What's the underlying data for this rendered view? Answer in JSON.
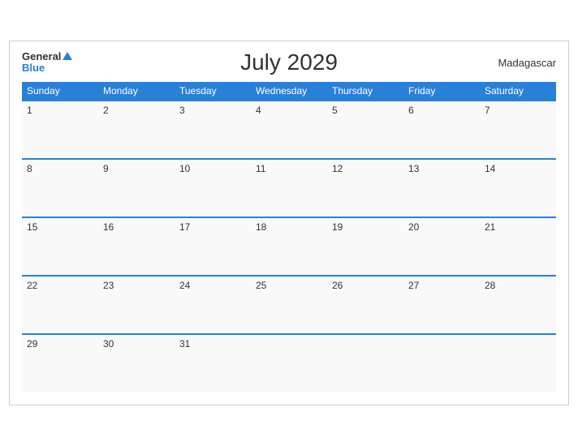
{
  "header": {
    "title": "July 2029",
    "country": "Madagascar",
    "logo_general": "General",
    "logo_blue": "Blue"
  },
  "weekdays": [
    "Sunday",
    "Monday",
    "Tuesday",
    "Wednesday",
    "Thursday",
    "Friday",
    "Saturday"
  ],
  "weeks": [
    [
      {
        "day": 1,
        "empty": false
      },
      {
        "day": 2,
        "empty": false
      },
      {
        "day": 3,
        "empty": false
      },
      {
        "day": 4,
        "empty": false
      },
      {
        "day": 5,
        "empty": false
      },
      {
        "day": 6,
        "empty": false
      },
      {
        "day": 7,
        "empty": false
      }
    ],
    [
      {
        "day": 8,
        "empty": false
      },
      {
        "day": 9,
        "empty": false
      },
      {
        "day": 10,
        "empty": false
      },
      {
        "day": 11,
        "empty": false
      },
      {
        "day": 12,
        "empty": false
      },
      {
        "day": 13,
        "empty": false
      },
      {
        "day": 14,
        "empty": false
      }
    ],
    [
      {
        "day": 15,
        "empty": false
      },
      {
        "day": 16,
        "empty": false
      },
      {
        "day": 17,
        "empty": false
      },
      {
        "day": 18,
        "empty": false
      },
      {
        "day": 19,
        "empty": false
      },
      {
        "day": 20,
        "empty": false
      },
      {
        "day": 21,
        "empty": false
      }
    ],
    [
      {
        "day": 22,
        "empty": false
      },
      {
        "day": 23,
        "empty": false
      },
      {
        "day": 24,
        "empty": false
      },
      {
        "day": 25,
        "empty": false
      },
      {
        "day": 26,
        "empty": false
      },
      {
        "day": 27,
        "empty": false
      },
      {
        "day": 28,
        "empty": false
      }
    ],
    [
      {
        "day": 29,
        "empty": false
      },
      {
        "day": 30,
        "empty": false
      },
      {
        "day": 31,
        "empty": false
      },
      {
        "day": null,
        "empty": true
      },
      {
        "day": null,
        "empty": true
      },
      {
        "day": null,
        "empty": true
      },
      {
        "day": null,
        "empty": true
      }
    ]
  ]
}
